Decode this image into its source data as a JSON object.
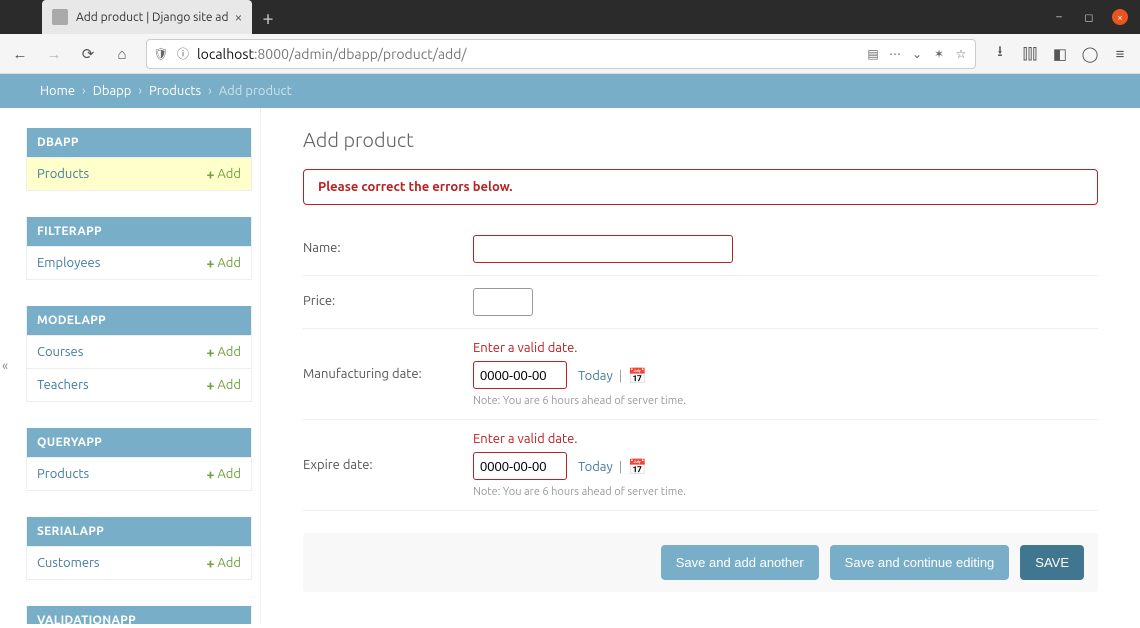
{
  "browser": {
    "tab_title": "Add product | Django site ad",
    "url_prefix": "localhost",
    "url_rest": ":8000/admin/dbapp/product/add/"
  },
  "breadcrumbs": {
    "home": "Home",
    "app": "Dbapp",
    "model": "Products",
    "current": "Add product"
  },
  "sidebar": {
    "apps": [
      {
        "name": "DBAPP",
        "models": [
          {
            "label": "Products",
            "add": "Add",
            "current": true
          }
        ]
      },
      {
        "name": "FILTERAPP",
        "models": [
          {
            "label": "Employees",
            "add": "Add"
          }
        ]
      },
      {
        "name": "MODELAPP",
        "models": [
          {
            "label": "Courses",
            "add": "Add"
          },
          {
            "label": "Teachers",
            "add": "Add"
          }
        ]
      },
      {
        "name": "QUERYAPP",
        "models": [
          {
            "label": "Products",
            "add": "Add"
          }
        ]
      },
      {
        "name": "SERIALAPP",
        "models": [
          {
            "label": "Customers",
            "add": "Add"
          }
        ]
      },
      {
        "name": "VALIDATIONAPP",
        "models": []
      }
    ]
  },
  "page": {
    "title": "Add product",
    "error_note": "Please correct the errors below.",
    "fields": {
      "name": {
        "label": "Name:",
        "value": ""
      },
      "price": {
        "label": "Price:",
        "value": ""
      },
      "mfg": {
        "label": "Manufacturing date:",
        "error": "Enter a valid date.",
        "value": "0000-00-00",
        "today": "Today",
        "help": "Note: You are 6 hours ahead of server time."
      },
      "exp": {
        "label": "Expire date:",
        "error": "Enter a valid date.",
        "value": "0000-00-00",
        "today": "Today",
        "help": "Note: You are 6 hours ahead of server time."
      }
    },
    "buttons": {
      "save_add_another": "Save and add another",
      "save_continue": "Save and continue editing",
      "save": "SAVE"
    }
  }
}
